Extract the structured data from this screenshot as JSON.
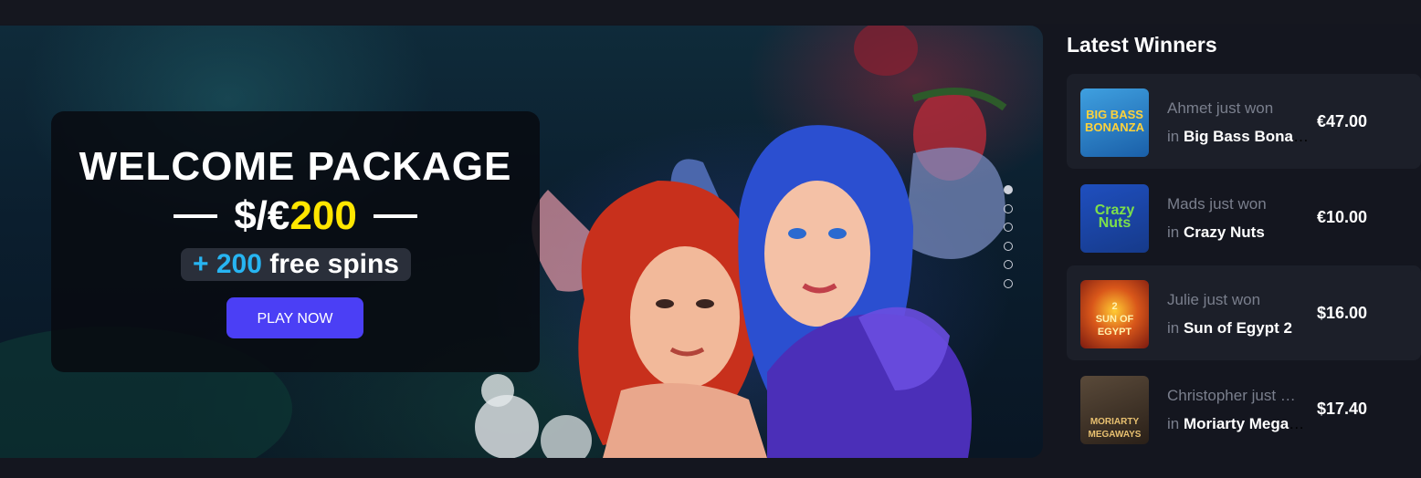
{
  "promo": {
    "title": "WELCOME PACKAGE",
    "amount_prefix": "$/€",
    "amount_value": "200",
    "spins_plus": "+ 200",
    "spins_text": "free spins",
    "cta_label": "PLAY NOW"
  },
  "carousel": {
    "slide_count": 6,
    "active_index": 0
  },
  "winners": {
    "title": "Latest Winners",
    "items": [
      {
        "name_line": "Ahmet just won",
        "in": "in",
        "game": "Big Bass Bonanza",
        "amount": "€47.00",
        "thumb_text": "BIG BASS\nBONANZA"
      },
      {
        "name_line": "Mads just won",
        "in": "in",
        "game": "Crazy Nuts",
        "amount": "€10.00",
        "thumb_text": "Crazy\nNuts"
      },
      {
        "name_line": "Julie just won",
        "in": "in",
        "game": "Sun of Egypt 2",
        "amount": "$16.00",
        "thumb_text": "2\nSUN OF EGYPT"
      },
      {
        "name_line": "Christopher just won",
        "in": "in",
        "game": "Moriarty Megaways",
        "amount": "$17.40",
        "thumb_text": "MORIARTY\nMEGAWAYS"
      }
    ]
  },
  "colors": {
    "accent_button": "#4b3ff5",
    "amount_yellow": "#ffe600",
    "spins_blue": "#27b5f2",
    "page_bg": "#14161f"
  }
}
